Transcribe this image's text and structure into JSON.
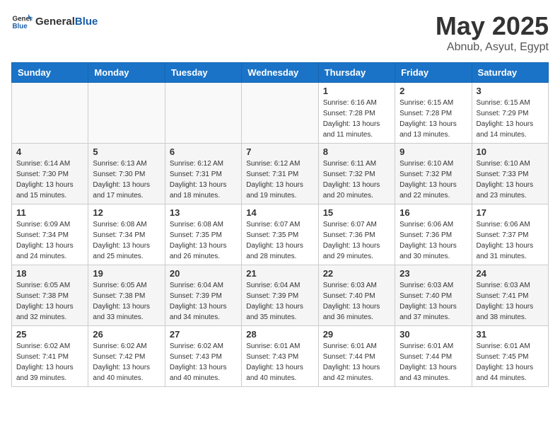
{
  "header": {
    "logo_general": "General",
    "logo_blue": "Blue",
    "month": "May 2025",
    "location": "Abnub, Asyut, Egypt"
  },
  "weekdays": [
    "Sunday",
    "Monday",
    "Tuesday",
    "Wednesday",
    "Thursday",
    "Friday",
    "Saturday"
  ],
  "weeks": [
    [
      {
        "day": "",
        "info": ""
      },
      {
        "day": "",
        "info": ""
      },
      {
        "day": "",
        "info": ""
      },
      {
        "day": "",
        "info": ""
      },
      {
        "day": "1",
        "info": "Sunrise: 6:16 AM\nSunset: 7:28 PM\nDaylight: 13 hours\nand 11 minutes."
      },
      {
        "day": "2",
        "info": "Sunrise: 6:15 AM\nSunset: 7:28 PM\nDaylight: 13 hours\nand 13 minutes."
      },
      {
        "day": "3",
        "info": "Sunrise: 6:15 AM\nSunset: 7:29 PM\nDaylight: 13 hours\nand 14 minutes."
      }
    ],
    [
      {
        "day": "4",
        "info": "Sunrise: 6:14 AM\nSunset: 7:30 PM\nDaylight: 13 hours\nand 15 minutes."
      },
      {
        "day": "5",
        "info": "Sunrise: 6:13 AM\nSunset: 7:30 PM\nDaylight: 13 hours\nand 17 minutes."
      },
      {
        "day": "6",
        "info": "Sunrise: 6:12 AM\nSunset: 7:31 PM\nDaylight: 13 hours\nand 18 minutes."
      },
      {
        "day": "7",
        "info": "Sunrise: 6:12 AM\nSunset: 7:31 PM\nDaylight: 13 hours\nand 19 minutes."
      },
      {
        "day": "8",
        "info": "Sunrise: 6:11 AM\nSunset: 7:32 PM\nDaylight: 13 hours\nand 20 minutes."
      },
      {
        "day": "9",
        "info": "Sunrise: 6:10 AM\nSunset: 7:32 PM\nDaylight: 13 hours\nand 22 minutes."
      },
      {
        "day": "10",
        "info": "Sunrise: 6:10 AM\nSunset: 7:33 PM\nDaylight: 13 hours\nand 23 minutes."
      }
    ],
    [
      {
        "day": "11",
        "info": "Sunrise: 6:09 AM\nSunset: 7:34 PM\nDaylight: 13 hours\nand 24 minutes."
      },
      {
        "day": "12",
        "info": "Sunrise: 6:08 AM\nSunset: 7:34 PM\nDaylight: 13 hours\nand 25 minutes."
      },
      {
        "day": "13",
        "info": "Sunrise: 6:08 AM\nSunset: 7:35 PM\nDaylight: 13 hours\nand 26 minutes."
      },
      {
        "day": "14",
        "info": "Sunrise: 6:07 AM\nSunset: 7:35 PM\nDaylight: 13 hours\nand 28 minutes."
      },
      {
        "day": "15",
        "info": "Sunrise: 6:07 AM\nSunset: 7:36 PM\nDaylight: 13 hours\nand 29 minutes."
      },
      {
        "day": "16",
        "info": "Sunrise: 6:06 AM\nSunset: 7:36 PM\nDaylight: 13 hours\nand 30 minutes."
      },
      {
        "day": "17",
        "info": "Sunrise: 6:06 AM\nSunset: 7:37 PM\nDaylight: 13 hours\nand 31 minutes."
      }
    ],
    [
      {
        "day": "18",
        "info": "Sunrise: 6:05 AM\nSunset: 7:38 PM\nDaylight: 13 hours\nand 32 minutes."
      },
      {
        "day": "19",
        "info": "Sunrise: 6:05 AM\nSunset: 7:38 PM\nDaylight: 13 hours\nand 33 minutes."
      },
      {
        "day": "20",
        "info": "Sunrise: 6:04 AM\nSunset: 7:39 PM\nDaylight: 13 hours\nand 34 minutes."
      },
      {
        "day": "21",
        "info": "Sunrise: 6:04 AM\nSunset: 7:39 PM\nDaylight: 13 hours\nand 35 minutes."
      },
      {
        "day": "22",
        "info": "Sunrise: 6:03 AM\nSunset: 7:40 PM\nDaylight: 13 hours\nand 36 minutes."
      },
      {
        "day": "23",
        "info": "Sunrise: 6:03 AM\nSunset: 7:40 PM\nDaylight: 13 hours\nand 37 minutes."
      },
      {
        "day": "24",
        "info": "Sunrise: 6:03 AM\nSunset: 7:41 PM\nDaylight: 13 hours\nand 38 minutes."
      }
    ],
    [
      {
        "day": "25",
        "info": "Sunrise: 6:02 AM\nSunset: 7:41 PM\nDaylight: 13 hours\nand 39 minutes."
      },
      {
        "day": "26",
        "info": "Sunrise: 6:02 AM\nSunset: 7:42 PM\nDaylight: 13 hours\nand 40 minutes."
      },
      {
        "day": "27",
        "info": "Sunrise: 6:02 AM\nSunset: 7:43 PM\nDaylight: 13 hours\nand 40 minutes."
      },
      {
        "day": "28",
        "info": "Sunrise: 6:01 AM\nSunset: 7:43 PM\nDaylight: 13 hours\nand 40 minutes."
      },
      {
        "day": "29",
        "info": "Sunrise: 6:01 AM\nSunset: 7:44 PM\nDaylight: 13 hours\nand 42 minutes."
      },
      {
        "day": "30",
        "info": "Sunrise: 6:01 AM\nSunset: 7:44 PM\nDaylight: 13 hours\nand 43 minutes."
      },
      {
        "day": "31",
        "info": "Sunrise: 6:01 AM\nSunset: 7:45 PM\nDaylight: 13 hours\nand 44 minutes."
      }
    ]
  ]
}
